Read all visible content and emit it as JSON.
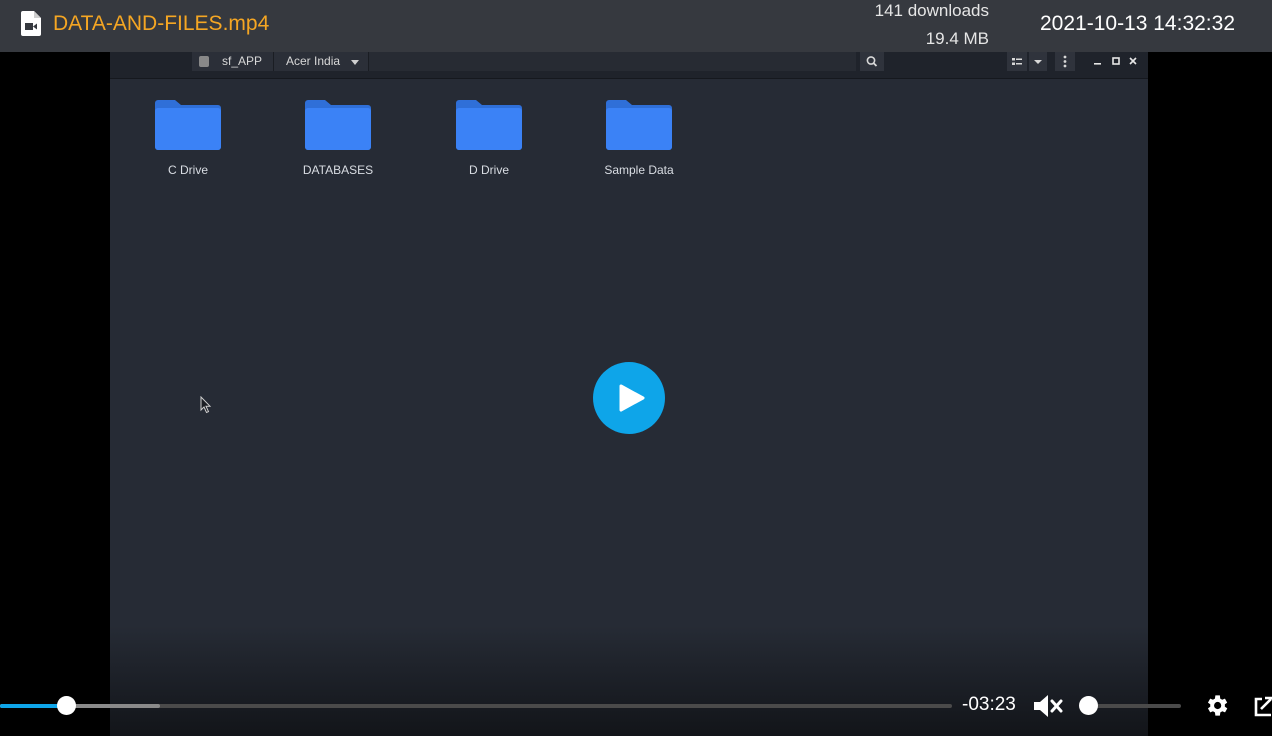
{
  "header": {
    "file_name": "DATA-AND-FILES.mp4",
    "downloads": "141 downloads",
    "file_size": "19.4 MB",
    "timestamp": "2021-10-13 14:32:32",
    "title_color": "#f5a623"
  },
  "video_frame": {
    "toolbar": {
      "breadcrumbs": [
        "sf_APP",
        "Acer India"
      ]
    },
    "folders": [
      {
        "label": "C Drive"
      },
      {
        "label": "DATABASES"
      },
      {
        "label": "D Drive"
      },
      {
        "label": "Sample Data"
      }
    ],
    "folder_color": "#3b82f6"
  },
  "player": {
    "time_remaining": "-03:23",
    "progress_fraction": 0.07,
    "buffered_fraction": 0.17,
    "volume_fraction": 0.0,
    "muted": true,
    "accent_color": "#0ea5e9",
    "icons": [
      "play-icon",
      "mute-icon",
      "settings-icon",
      "popout-icon"
    ]
  }
}
